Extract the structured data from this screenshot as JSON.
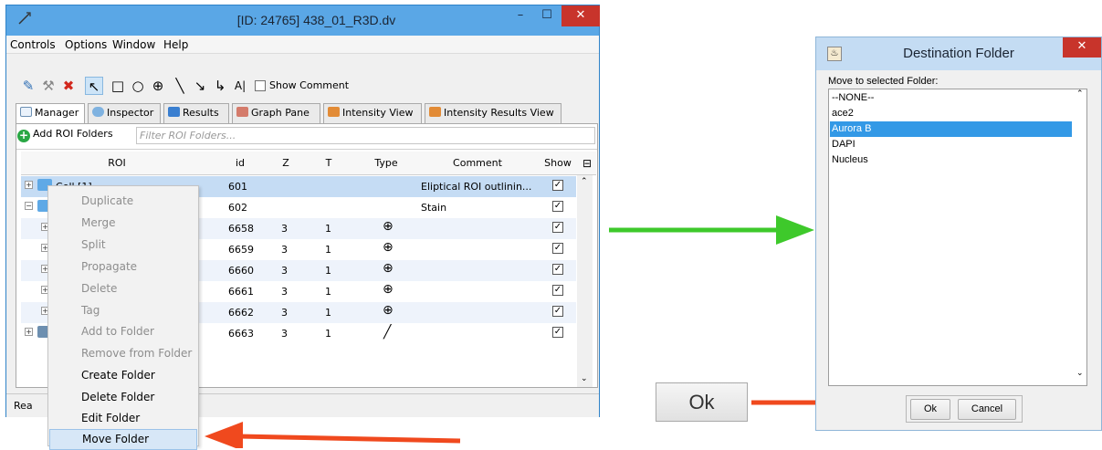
{
  "main_window": {
    "title": "[ID: 24765] 438_01_R3D.dv",
    "controls": {
      "minimize": "–",
      "maximize": "☐",
      "close": "✕"
    },
    "menu": [
      "Controls",
      "Options",
      "Window",
      "Help"
    ],
    "toolbar": {
      "show_comment_label": "Show Comment"
    },
    "tabs": [
      "Manager",
      "Inspector",
      "Results",
      "Graph Pane",
      "Intensity View",
      "Intensity Results View"
    ],
    "add_roi_folders_label": "Add ROI Folders",
    "filter_placeholder": "Filter ROI Folders...",
    "columns": [
      "ROI",
      "id",
      "Z",
      "T",
      "Type",
      "Comment",
      "Show"
    ],
    "rows": [
      {
        "roi": "Cell [1]",
        "id": "601",
        "z": "",
        "t": "",
        "type": "",
        "comment": "Eliptical ROI outlinin...",
        "show": true
      },
      {
        "roi": "",
        "id": "602",
        "z": "",
        "t": "",
        "type": "",
        "comment": "Stain",
        "show": true
      },
      {
        "roi": "",
        "id": "6658",
        "z": "3",
        "t": "1",
        "type": "ellipse",
        "comment": "",
        "show": true
      },
      {
        "roi": "",
        "id": "6659",
        "z": "3",
        "t": "1",
        "type": "ellipse",
        "comment": "",
        "show": true
      },
      {
        "roi": "",
        "id": "6660",
        "z": "3",
        "t": "1",
        "type": "ellipse",
        "comment": "",
        "show": true
      },
      {
        "roi": "",
        "id": "6661",
        "z": "3",
        "t": "1",
        "type": "ellipse",
        "comment": "",
        "show": true
      },
      {
        "roi": "",
        "id": "6662",
        "z": "3",
        "t": "1",
        "type": "ellipse",
        "comment": "",
        "show": true
      },
      {
        "roi": "",
        "id": "6663",
        "z": "3",
        "t": "1",
        "type": "line",
        "comment": "",
        "show": true
      }
    ],
    "status_text": "Rea"
  },
  "context_menu": {
    "items": [
      {
        "label": "Duplicate",
        "enabled": false
      },
      {
        "label": "Merge",
        "enabled": false
      },
      {
        "label": "Split",
        "enabled": false
      },
      {
        "label": "Propagate",
        "enabled": false
      },
      {
        "label": "Delete",
        "enabled": false
      },
      {
        "label": "Tag",
        "enabled": false
      },
      {
        "label": "Add to Folder",
        "enabled": false
      },
      {
        "label": "Remove from Folder",
        "enabled": false
      },
      {
        "label": "Create Folder",
        "enabled": true
      },
      {
        "label": "Delete Folder",
        "enabled": true
      },
      {
        "label": "Edit Folder",
        "enabled": true
      },
      {
        "label": "Move Folder",
        "enabled": true,
        "highlighted": true
      }
    ]
  },
  "dialog": {
    "title": "Destination Folder",
    "label": "Move to selected Folder:",
    "folders": [
      "--NONE--",
      "ace2",
      "Aurora B",
      "DAPI",
      "Nucleus"
    ],
    "selected": "Aurora B",
    "ok_label": "Ok",
    "cancel_label": "Cancel"
  },
  "callout_ok_label": "Ok",
  "colors": {
    "arrow_red": "#f0491e",
    "arrow_green": "#3ec92b",
    "selection_blue": "#3399e6",
    "title_blue": "#5aa7e6"
  }
}
